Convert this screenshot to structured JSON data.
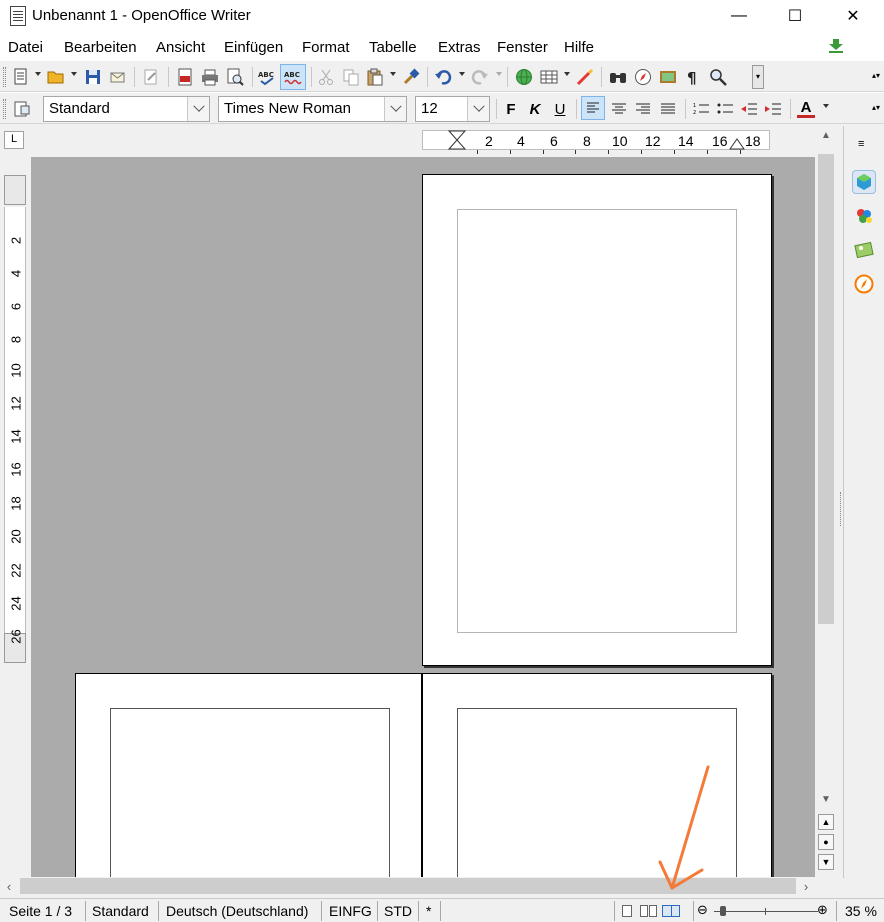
{
  "window": {
    "title": "Unbenannt 1 - OpenOffice Writer",
    "minimize_glyph": "—",
    "maximize_glyph": "☐",
    "close_glyph": "✕"
  },
  "menu": {
    "items": [
      "Datei",
      "Bearbeiten",
      "Ansicht",
      "Einfügen",
      "Format",
      "Tabelle",
      "Extras",
      "Fenster",
      "Hilfe"
    ]
  },
  "standard_toolbar": {
    "icons": [
      "new-icon",
      "open-icon",
      "save-icon",
      "email-icon",
      "edit-file-icon",
      "pdf-export-icon",
      "print-icon",
      "page-preview-icon",
      "spellcheck-icon",
      "autospellcheck-icon",
      "cut-icon",
      "copy-icon",
      "paste-icon",
      "clone-format-icon",
      "undo-icon",
      "redo-icon",
      "navigator-globe-icon",
      "table-icon",
      "draw-functions-icon",
      "find-replace-icon",
      "navigator-icon",
      "gallery-icon",
      "formatting-marks-icon",
      "zoom-icon"
    ]
  },
  "formatting_toolbar": {
    "paragraph_style": "Standard",
    "font_name": "Times New Roman",
    "font_size": "12",
    "bold_label": "F",
    "italic_label": "K",
    "underline_label": "U",
    "font_color_label": "A"
  },
  "ruler": {
    "corner_glyph": "L",
    "horizontal_labels": [
      "2",
      "4",
      "6",
      "8",
      "10",
      "12",
      "14",
      "16",
      "18"
    ],
    "vertical_labels": [
      "2",
      "4",
      "6",
      "8",
      "10",
      "12",
      "14",
      "16",
      "18",
      "20",
      "22",
      "24",
      "26"
    ]
  },
  "statusbar": {
    "page": "Seite 1 / 3",
    "page_style": "Standard",
    "language": "Deutsch (Deutschland)",
    "insert_mode": "EINFG",
    "selection_mode": "STD",
    "modified": "*",
    "zoom": "35 %",
    "zoom_minus": "⊖",
    "zoom_plus": "⊕"
  },
  "colors": {
    "annotation_arrow": "#f47a38",
    "document_background": "#ababab",
    "active_button": "#cce4f7"
  }
}
